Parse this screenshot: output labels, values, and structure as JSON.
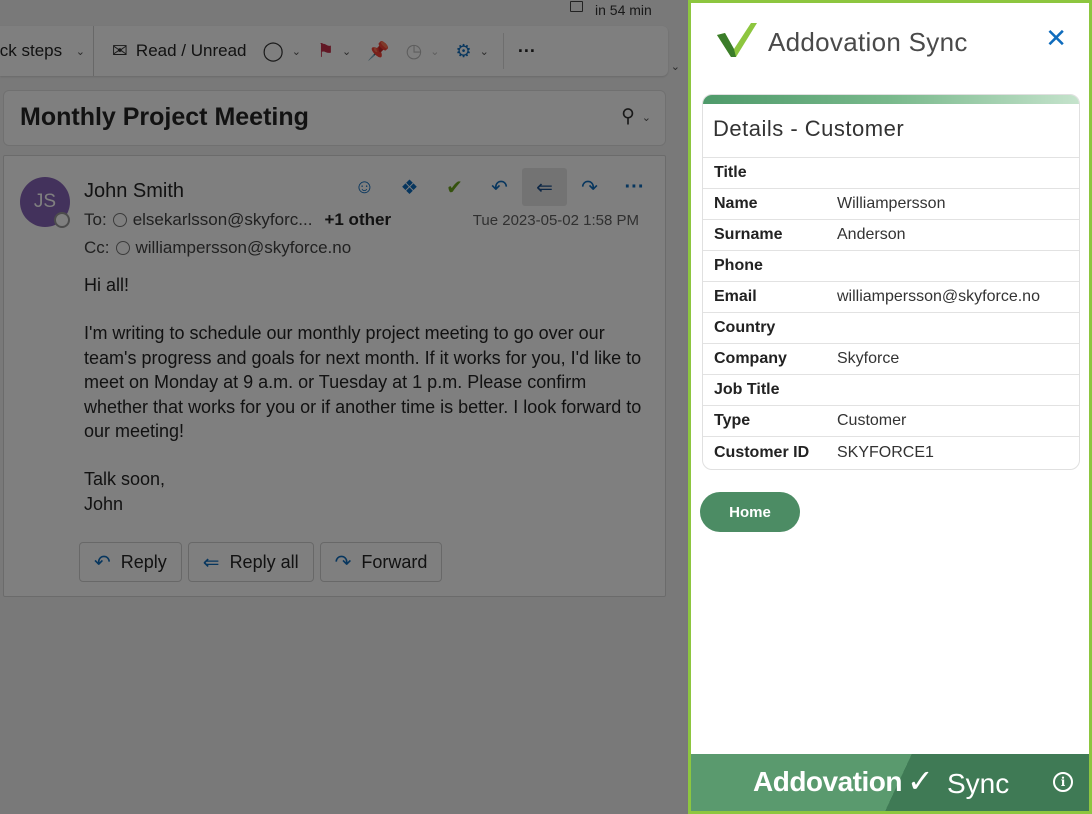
{
  "reminder": {
    "text": "in 54 min"
  },
  "toolbar": {
    "quick_steps": "ick steps",
    "read_unread": "Read / Unread",
    "more": "···"
  },
  "email": {
    "subject": "Monthly Project Meeting",
    "avatar_initials": "JS",
    "sender": "John Smith",
    "to_label": "To:",
    "to_address": "elsekarlsson@skyforc...",
    "to_more": "+1 other",
    "date": "Tue 2023-05-02 1:58 PM",
    "cc_label": "Cc:",
    "cc_address": "williampersson@skyforce.no",
    "body": [
      "Hi all!",
      "I'm writing to schedule our monthly project meeting to go over our team's progress and goals for next month. If it works for you, I'd like to meet on Monday at 9 a.m. or Tuesday at 1 p.m. Please confirm whether that works for you or if another time is better. I look forward to our meeting!",
      "Talk soon,",
      "John"
    ],
    "buttons": {
      "reply": "Reply",
      "reply_all": "Reply all",
      "forward": "Forward"
    }
  },
  "addin": {
    "title": "Addovation Sync",
    "card_title": "Details - Customer",
    "fields": [
      {
        "label": "Title",
        "value": ""
      },
      {
        "label": "Name",
        "value": "Williampersson"
      },
      {
        "label": "Surname",
        "value": "Anderson"
      },
      {
        "label": "Phone",
        "value": ""
      },
      {
        "label": "Email",
        "value": "williampersson@skyforce.no"
      },
      {
        "label": "Country",
        "value": ""
      },
      {
        "label": "Company",
        "value": "Skyforce"
      },
      {
        "label": "Job Title",
        "value": ""
      },
      {
        "label": "Type",
        "value": "Customer"
      },
      {
        "label": "Customer ID",
        "value": "SKYFORCE1"
      }
    ],
    "home_button": "Home",
    "footer_brand": "Addovation",
    "footer_sync": "Sync"
  },
  "colors": {
    "accent_green": "#8dc63f",
    "button_green": "#4c8c64",
    "outlook_blue": "#0f6cbd",
    "avatar_purple": "#8764b8"
  }
}
